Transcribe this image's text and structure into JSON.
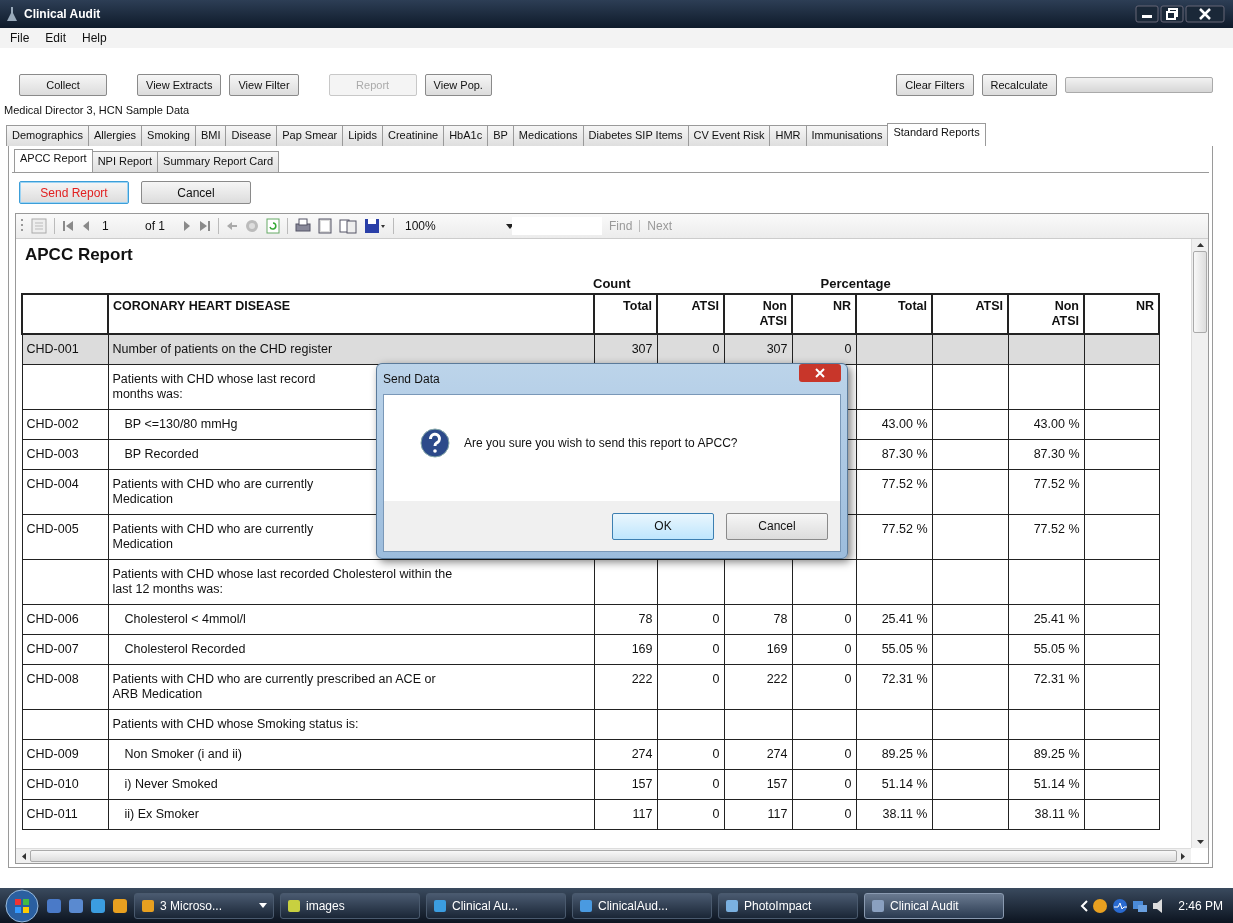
{
  "window": {
    "title": "Clinical Audit"
  },
  "menu": [
    "File",
    "Edit",
    "Help"
  ],
  "toolbar": {
    "buttons": [
      {
        "label": "Collect",
        "disabled": false
      },
      {
        "label": "View Extracts",
        "disabled": false
      },
      {
        "label": "View Filter",
        "disabled": false
      },
      {
        "label": "Report",
        "disabled": true
      },
      {
        "label": "View Pop.",
        "disabled": false
      }
    ],
    "right_buttons": [
      {
        "label": "Clear Filters",
        "disabled": false
      },
      {
        "label": "Recalculate",
        "disabled": false
      }
    ],
    "progress": {
      "level": 0
    }
  },
  "data_source": "Medical Director 3, HCN Sample Data",
  "tabs": [
    {
      "label": "Demographics",
      "selected": false
    },
    {
      "label": "Allergies",
      "selected": false
    },
    {
      "label": "Smoking",
      "selected": false
    },
    {
      "label": "BMI",
      "selected": false
    },
    {
      "label": "Disease",
      "selected": false
    },
    {
      "label": "Pap Smear",
      "selected": false
    },
    {
      "label": "Lipids",
      "selected": false
    },
    {
      "label": "Creatinine",
      "selected": false
    },
    {
      "label": "HbA1c",
      "selected": false
    },
    {
      "label": "BP",
      "selected": false
    },
    {
      "label": "Medications",
      "selected": false
    },
    {
      "label": "Diabetes SIP Items",
      "selected": false
    },
    {
      "label": "CV Event Risk",
      "selected": false
    },
    {
      "label": "HMR",
      "selected": false
    },
    {
      "label": "Immunisations",
      "selected": false
    },
    {
      "label": "Standard Reports",
      "selected": true
    }
  ],
  "subtabs": [
    {
      "label": "APCC Report",
      "selected": true
    },
    {
      "label": "NPI Report",
      "selected": false
    },
    {
      "label": "Summary Report Card",
      "selected": false
    }
  ],
  "actions": [
    {
      "label": "Send Report",
      "focused": true
    },
    {
      "label": "Cancel",
      "focused": false
    }
  ],
  "viewer": {
    "page": "1",
    "page_count": "of 1",
    "zoom": "100%",
    "find": "Find",
    "next": "Next"
  },
  "report": {
    "title": "APCC Report",
    "groups": [
      "Count",
      "Percentage"
    ],
    "columns": [
      "CORONARY HEART DISEASE",
      "Total",
      "ATSI",
      "Non ATSI",
      "NR",
      "Total",
      "ATSI",
      "Non ATSI",
      "NR"
    ],
    "rows": [
      {
        "code": "CHD-001",
        "lines": [
          "Number of patients on the CHD register"
        ],
        "selected": true,
        "values": {
          "c_total": "307",
          "c_atsi": "0",
          "c_non": "307",
          "c_nr": "0"
        }
      },
      {
        "lines": [
          "Patients with CHD whose last record",
          "months was:"
        ],
        "selected": false,
        "values": {},
        "children": [
          {
            "code": "CHD-002",
            "lines": [
              "BP <=130/80 mmHg"
            ],
            "selected": false,
            "values": {
              "p_total": "43.00 %",
              "p_non": "43.00 %"
            }
          },
          {
            "code": "CHD-003",
            "lines": [
              "BP Recorded"
            ],
            "selected": false,
            "values": {
              "p_total": "87.30 %",
              "p_non": "87.30 %"
            }
          }
        ]
      },
      {
        "code": "CHD-004",
        "lines": [
          "Patients with CHD who are currently",
          "Medication"
        ],
        "selected": false,
        "values": {
          "p_total": "77.52 %",
          "p_non": "77.52 %"
        }
      },
      {
        "code": "CHD-005",
        "lines": [
          "Patients with CHD who are currently",
          "Medication"
        ],
        "selected": false,
        "values": {
          "p_total": "77.52 %",
          "p_non": "77.52 %"
        }
      },
      {
        "lines": [
          "Patients with CHD whose last recorded Cholesterol within the",
          "last 12 months was:"
        ],
        "selected": false,
        "values": {},
        "children": [
          {
            "code": "CHD-006",
            "lines": [
              "Cholesterol < 4mmol/l"
            ],
            "selected": false,
            "values": {
              "c_total": "78",
              "c_atsi": "0",
              "c_non": "78",
              "c_nr": "0",
              "p_total": "25.41 %",
              "p_non": "25.41 %"
            }
          },
          {
            "code": "CHD-007",
            "lines": [
              "Cholesterol Recorded"
            ],
            "selected": false,
            "values": {
              "c_total": "169",
              "c_atsi": "0",
              "c_non": "169",
              "c_nr": "0",
              "p_total": "55.05 %",
              "p_non": "55.05 %"
            }
          }
        ]
      },
      {
        "code": "CHD-008",
        "lines": [
          "Patients with CHD who are currently prescribed an ACE or",
          "ARB Medication"
        ],
        "selected": false,
        "values": {
          "c_total": "222",
          "c_atsi": "0",
          "c_non": "222",
          "c_nr": "0",
          "p_total": "72.31 %",
          "p_non": "72.31 %"
        }
      },
      {
        "lines": [
          "Patients with CHD whose Smoking status is:"
        ],
        "selected": false,
        "values": {},
        "children": [
          {
            "code": "CHD-009",
            "lines": [
              "Non Smoker (i and ii)"
            ],
            "selected": false,
            "values": {
              "c_total": "274",
              "c_atsi": "0",
              "c_non": "274",
              "c_nr": "0",
              "p_total": "89.25 %",
              "p_non": "89.25 %"
            }
          },
          {
            "code": "CHD-010",
            "lines": [
              "i) Never Smoked"
            ],
            "selected": false,
            "values": {
              "c_total": "157",
              "c_atsi": "0",
              "c_non": "157",
              "c_nr": "0",
              "p_total": "51.14 %",
              "p_non": "51.14 %"
            }
          },
          {
            "code": "CHD-011",
            "lines": [
              "ii) Ex Smoker"
            ],
            "selected": false,
            "values": {
              "c_total": "117",
              "c_atsi": "0",
              "c_non": "117",
              "c_nr": "0",
              "p_total": "38.11 %",
              "p_non": "38.11 %"
            }
          }
        ]
      }
    ]
  },
  "dialog": {
    "title": "Send Data",
    "message": "Are you sure you wish to send this report to APCC?",
    "buttons": [
      {
        "label": "OK",
        "selected": true
      },
      {
        "label": "Cancel",
        "selected": false
      }
    ]
  },
  "taskbar": {
    "items": [
      {
        "label": "3 Microso...",
        "selected": false,
        "has_menu": true
      },
      {
        "label": "images",
        "selected": false,
        "has_menu": false
      },
      {
        "label": "Clinical Au...",
        "selected": false,
        "has_menu": false
      },
      {
        "label": "ClinicalAud...",
        "selected": false,
        "has_menu": false
      },
      {
        "label": "PhotoImpact",
        "selected": false,
        "has_menu": false
      },
      {
        "label": "Clinical Audit",
        "selected": true,
        "has_menu": false
      }
    ],
    "clock": "2:46 PM"
  }
}
